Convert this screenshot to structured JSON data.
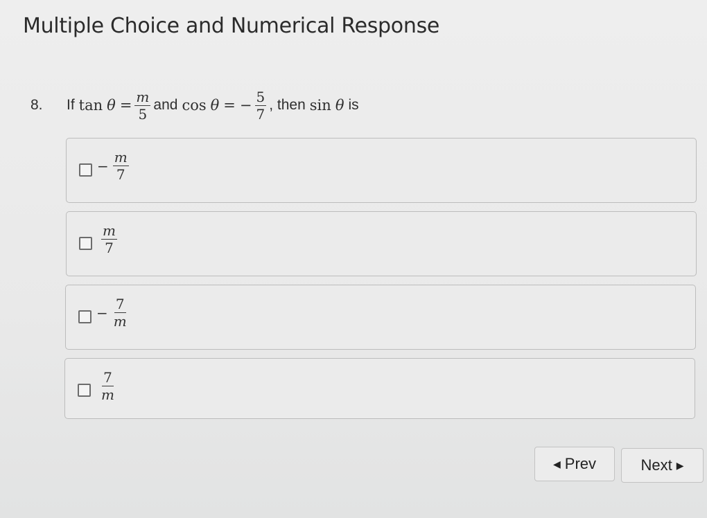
{
  "page": {
    "title": "Multiple Choice and Numerical Response"
  },
  "question": {
    "number": "8.",
    "if_text": "If",
    "tan": "tan",
    "theta": "θ",
    "equals": "=",
    "tan_num": "m",
    "tan_den": "5",
    "and_text": "and",
    "cos": "cos",
    "minus": "−",
    "cos_num": "5",
    "cos_den": "7",
    "then_text": ", then",
    "sin": "sin",
    "is_text": "is"
  },
  "options": [
    {
      "sign": "−",
      "num": "m",
      "den": "7"
    },
    {
      "sign": "",
      "num": "m",
      "den": "7"
    },
    {
      "sign": "−",
      "num": "7",
      "den": "m"
    },
    {
      "sign": "",
      "num": "7",
      "den": "m"
    }
  ],
  "nav": {
    "prev_label": "Prev",
    "next_label": "Next",
    "prev_icon": "triangle-left-icon",
    "next_icon": "triangle-right-icon"
  }
}
